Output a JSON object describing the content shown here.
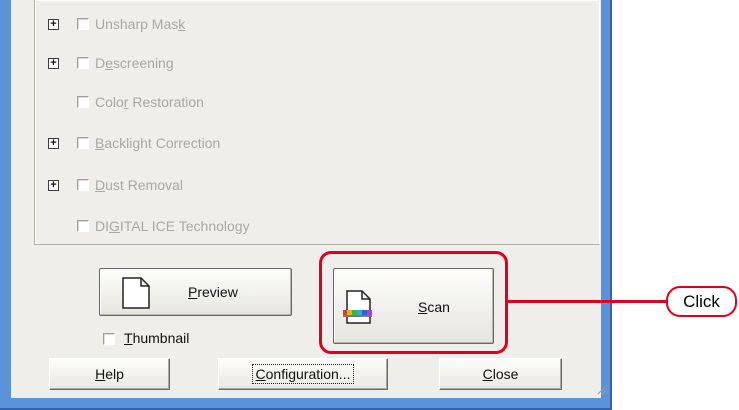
{
  "options": [
    {
      "label_pre": "Unsharp Mas",
      "label_ul": "k",
      "label_post": "",
      "expandable": true
    },
    {
      "label_pre": "D",
      "label_ul": "e",
      "label_post": "screening",
      "expandable": true
    },
    {
      "label_pre": "Colo",
      "label_ul": "r",
      "label_post": " Restoration",
      "expandable": false
    },
    {
      "label_pre": "",
      "label_ul": "B",
      "label_post": "acklight Correction",
      "expandable": true
    },
    {
      "label_pre": "",
      "label_ul": "D",
      "label_post": "ust Removal",
      "expandable": true
    },
    {
      "label_pre": "DI",
      "label_ul": "G",
      "label_post": "ITAL ICE Technology",
      "expandable": false
    }
  ],
  "expander_glyph": "+",
  "preview_button": {
    "label_pre": "",
    "label_ul": "P",
    "label_post": "review"
  },
  "scan_button": {
    "label_pre": "",
    "label_ul": "S",
    "label_post": "can"
  },
  "thumbnail": {
    "label_pre": "",
    "label_ul": "T",
    "label_post": "humbnail",
    "checked": false
  },
  "help_button": {
    "label_pre": "",
    "label_ul": "H",
    "label_post": "elp"
  },
  "configuration_button": {
    "label_pre": "",
    "label_ul": "C",
    "label_post": "onfiguration..."
  },
  "close_button": {
    "label_pre": "",
    "label_ul": "C",
    "label_post": "lose"
  },
  "callout": {
    "text": "Click"
  },
  "colors": {
    "highlight": "#e0001b",
    "frame": "#5a93d8",
    "dialog": "#efeeea",
    "disabled_text": "#a9a8a2"
  }
}
